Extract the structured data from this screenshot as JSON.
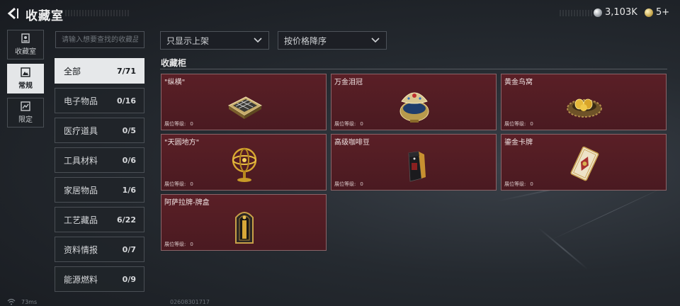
{
  "header": {
    "title": "收藏室"
  },
  "currency": [
    {
      "icon": "silver-coin-icon",
      "value": "3,103K"
    },
    {
      "icon": "gold-coin-icon",
      "value": "5+"
    }
  ],
  "rail": [
    {
      "label": "收藏室",
      "icon": "collection-room-icon",
      "active": false
    },
    {
      "label": "常规",
      "icon": "regular-icon",
      "active": true
    },
    {
      "label": "限定",
      "icon": "limited-icon",
      "active": false
    }
  ],
  "search": {
    "placeholder": "请输入想要查找的收藏品",
    "value": ""
  },
  "filters": {
    "shelf": "只显示上架",
    "sort": "按价格降序"
  },
  "categories": [
    {
      "label": "全部",
      "count": "7/71"
    },
    {
      "label": "电子物品",
      "count": "0/16"
    },
    {
      "label": "医疗道具",
      "count": "0/5"
    },
    {
      "label": "工具材料",
      "count": "0/6"
    },
    {
      "label": "家居物品",
      "count": "1/6"
    },
    {
      "label": "工艺藏品",
      "count": "6/22"
    },
    {
      "label": "资料情报",
      "count": "0/7"
    },
    {
      "label": "能源燃料",
      "count": "0/9"
    }
  ],
  "section": {
    "title": "收藏柜"
  },
  "items": [
    {
      "name": "\"纵横\"",
      "level_label": "展位等级:",
      "level": "0",
      "icon": "chessboard-icon"
    },
    {
      "name": "万金泪冠",
      "level_label": "展位等级:",
      "level": "0",
      "icon": "jeweled-egg-icon"
    },
    {
      "name": "黄金鸟窝",
      "level_label": "展位等级:",
      "level": "0",
      "icon": "golden-nest-icon"
    },
    {
      "name": "\"天圆地方\"",
      "level_label": "展位等级:",
      "level": "0",
      "icon": "armillary-sphere-icon"
    },
    {
      "name": "高级咖啡豆",
      "level_label": "展位等级:",
      "level": "0",
      "icon": "coffee-bag-icon"
    },
    {
      "name": "鎏金卡牌",
      "level_label": "展位等级:",
      "level": "0",
      "icon": "gilded-card-icon"
    },
    {
      "name": "阿萨拉牌-牌盒",
      "level_label": "展位等级:",
      "level": "0",
      "icon": "card-box-icon"
    }
  ],
  "status": {
    "ping": "73ms",
    "uid": "02608301717"
  },
  "colors": {
    "card_bg": "#4f1c23",
    "active_bg": "#e6e8ea",
    "panel_bg": "#202429"
  }
}
